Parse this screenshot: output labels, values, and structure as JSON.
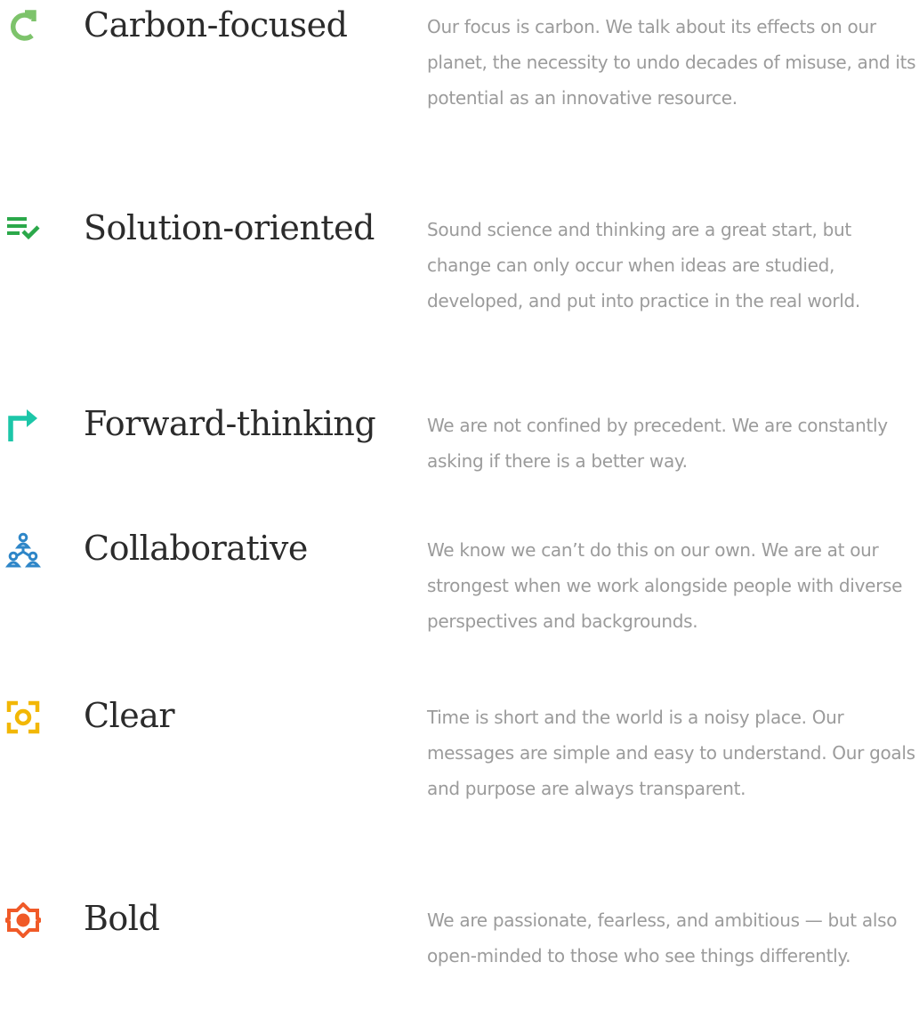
{
  "values": [
    {
      "icon": "refresh-arrow-icon",
      "icon_color": "#7DC36B",
      "title": "Carbon-focused",
      "description": "Our focus is carbon. We talk about its effects on our planet, the necessity to undo decades of misuse, and its potential as an innovative resource."
    },
    {
      "icon": "list-check-icon",
      "icon_color": "#2BA84A",
      "title": "Solution-oriented",
      "description": "Sound science and thinking are a great start, but change can only occur when ideas are studied, developed, and put into practice in the real world."
    },
    {
      "icon": "turn-right-arrow-icon",
      "icon_color": "#1CC6A8",
      "title": "Forward-thinking",
      "description": "We are not confined by precedent. We are constantly asking if there is a better way."
    },
    {
      "icon": "people-network-icon",
      "icon_color": "#2E86C8",
      "title": "Collaborative",
      "description": "We know we can’t do this on our own. We are at our strongest when we work alongside people with diverse perspectives and backgrounds."
    },
    {
      "icon": "focus-target-icon",
      "icon_color": "#F2B705",
      "title": "Clear",
      "description": "Time is short and the world is a noisy place. Our messages are simple and easy to understand. Our goals and purpose are always transparent."
    },
    {
      "icon": "sun-badge-icon",
      "icon_color": "#F05A28",
      "title": "Bold",
      "description": "We are passionate, fearless, and ambitious — but also open-minded to those who see things differently."
    }
  ]
}
